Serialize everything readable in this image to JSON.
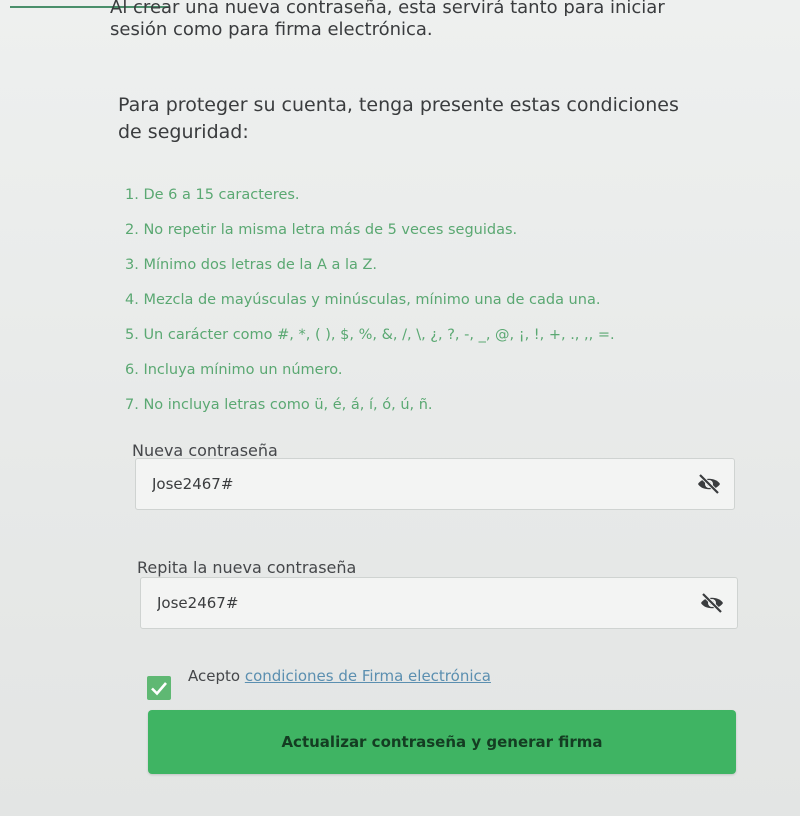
{
  "intro": {
    "line1": "Al crear una nueva contraseña, esta servirá tanto para iniciar",
    "line2": "sesión como para firma electrónica."
  },
  "conditions_intro": "Para proteger su cuenta, tenga presente estas condiciones de seguridad:",
  "rules": [
    "1. De 6 a 15 caracteres.",
    "2. No repetir la misma letra más de 5 veces seguidas.",
    "3. Mínimo dos letras de la A a la Z.",
    "4. Mezcla de mayúsculas y minúsculas, mínimo una de cada una.",
    "5. Un carácter como #, *, ( ), $, %, &, /, \\, ¿, ?, -, _, @, ¡, !, +, ., ,, =.",
    "6. Incluya mínimo un número.",
    "7. No incluya letras como ü, é, á, í, ó, ú, ñ."
  ],
  "new_password": {
    "label": "Nueva contraseña",
    "value": "Jose2467#",
    "icon": "eye-slash-icon"
  },
  "repeat_password": {
    "label": "Repita la nueva contraseña",
    "value": "Jose2467#",
    "icon": "eye-slash-icon"
  },
  "terms": {
    "checked": true,
    "prefix": "Acepto ",
    "link": "condiciones de Firma electrónica"
  },
  "submit_label": "Actualizar contraseña y generar firma",
  "colors": {
    "accent": "#3fb463",
    "rules_text": "#5aa872",
    "link": "#5b8fb0"
  }
}
